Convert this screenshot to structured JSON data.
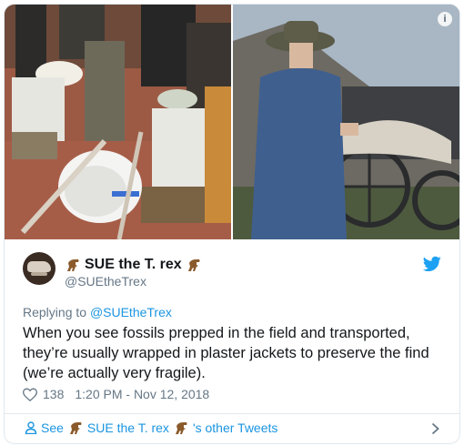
{
  "media": {
    "left_photo": "field crew wrapping fossil in plaster jacket",
    "right_photo": "person in hat beside wagon carrying plaster-jacketed fossil"
  },
  "author": {
    "display_name": "SUE the T. rex",
    "handle": "@SUEtheTrex",
    "emoji": "t-rex-emoji"
  },
  "tweet": {
    "reply_prefix": "Replying to",
    "reply_to": "@SUEtheTrex",
    "text_lines": [
      "When you see fossils prepped in the field and transported,",
      "they’re usually wrapped in plaster jackets to preserve the find",
      "(we’re actually very fragile)."
    ],
    "likes": "138",
    "timestamp": "1:20 PM - Nov 12, 2018"
  },
  "footer": {
    "see": "See",
    "name": "SUE the T. rex",
    "suffix": "'s other Tweets"
  },
  "colors": {
    "accent": "#1b95e0",
    "muted": "#657786",
    "border": "#e1e8ed",
    "twitter_blue": "#1da1f2"
  }
}
